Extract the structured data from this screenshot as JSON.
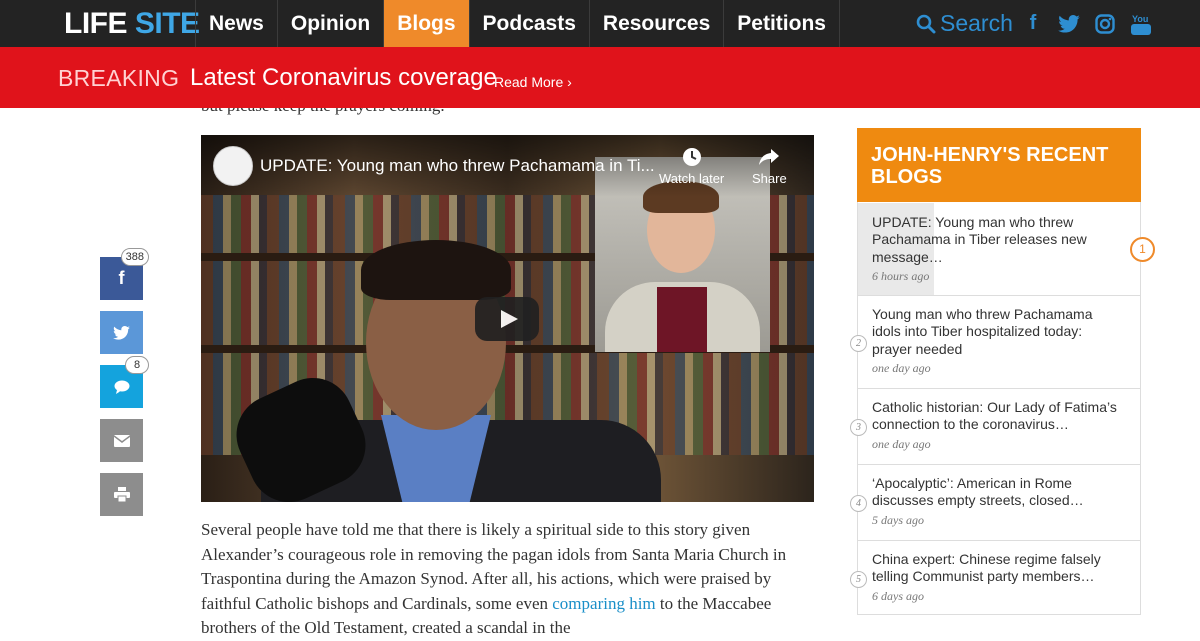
{
  "site": {
    "logo_life": "LIFE",
    "logo_site": "SITE"
  },
  "nav": {
    "items": [
      {
        "label": "News"
      },
      {
        "label": "Opinion"
      },
      {
        "label": "Blogs"
      },
      {
        "label": "Podcasts"
      },
      {
        "label": "Resources"
      },
      {
        "label": "Petitions"
      }
    ],
    "active": "Blogs",
    "search_label": "Search",
    "social_icons": [
      "facebook-icon",
      "twitter-icon",
      "instagram-icon",
      "youtube-icon"
    ]
  },
  "breaking": {
    "label": "BREAKING",
    "headline": "Latest Coronavirus coverage",
    "read_more": "Read More ›"
  },
  "article": {
    "cut_line": "but please keep the prayers coming.",
    "video": {
      "title": "UPDATE: Young man who threw Pachamama in Ti...",
      "watch_later": "Watch later",
      "share": "Share"
    },
    "paragraph_1": "Several people have told me that there is likely a spiritual side to this story given Alexander’s courageous role in removing the pagan idols from Santa Maria Church in Traspontina during the Amazon Synod. After all, his actions, which were praised by faithful Catholic bishops and Cardinals, some even ",
    "paragraph_link": "comparing him",
    "paragraph_2": " to the Maccabee brothers of the Old Testament, created a scandal in the"
  },
  "share_rail": {
    "facebook_count": "388",
    "comment_count": "8"
  },
  "sidebar": {
    "heading": "JOHN-HENRY'S RECENT BLOGS",
    "items": [
      {
        "number": "1",
        "title": "UPDATE: Young man who threw Pachamama in Tiber releases new message…",
        "time": "6 hours ago"
      },
      {
        "number": "2",
        "title": "Young man who threw Pachamama idols into Tiber hospitalized today: prayer needed",
        "time": "one day ago"
      },
      {
        "number": "3",
        "title": "Catholic historian: Our Lady of Fatima’s connection to the coronavirus…",
        "time": "one day ago"
      },
      {
        "number": "4",
        "title": "‘Apocalyptic’: American in Rome discusses empty streets, closed…",
        "time": "5 days ago"
      },
      {
        "number": "5",
        "title": "China expert: Chinese regime falsely telling Communist party members…",
        "time": "6 days ago"
      }
    ]
  },
  "colors": {
    "nav_bg": "#232323",
    "accent_orange": "#ef8a2a",
    "breaking_red": "#e0131b",
    "link_blue": "#1a8fc8"
  }
}
